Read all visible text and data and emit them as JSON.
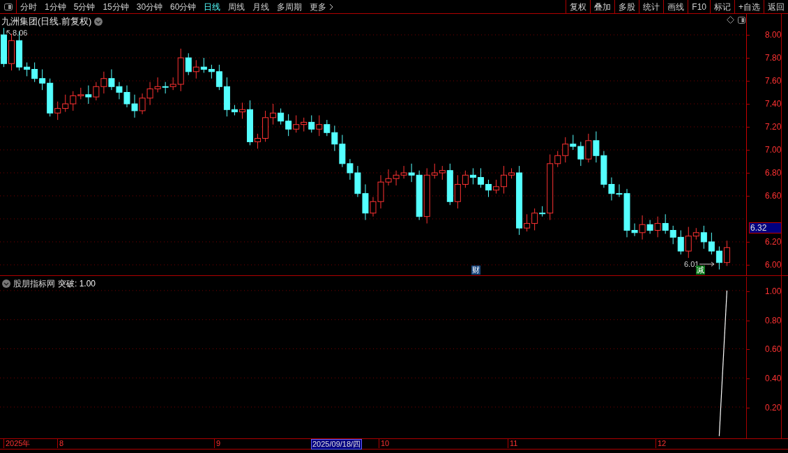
{
  "toolbar": {
    "periods": [
      {
        "label": "分时",
        "selected": false
      },
      {
        "label": "1分钟",
        "selected": false
      },
      {
        "label": "5分钟",
        "selected": false
      },
      {
        "label": "15分钟",
        "selected": false
      },
      {
        "label": "30分钟",
        "selected": false
      },
      {
        "label": "60分钟",
        "selected": false
      },
      {
        "label": "日线",
        "selected": true
      },
      {
        "label": "周线",
        "selected": false
      },
      {
        "label": "月线",
        "selected": false
      },
      {
        "label": "多周期",
        "selected": false
      },
      {
        "label": "更多",
        "selected": false
      }
    ],
    "actions": [
      "复权",
      "叠加",
      "多股",
      "统计",
      "画线",
      "F10",
      "标记",
      "+自选",
      "返回"
    ]
  },
  "main_chart": {
    "title": "九洲集团(日线.前复权)",
    "y_ticks": [
      "8.00",
      "7.80",
      "7.60",
      "7.40",
      "7.20",
      "7.00",
      "6.80",
      "6.60",
      "6.20",
      "6.00"
    ],
    "current_price": "6.32",
    "high_label": "8.06",
    "low_label": "6.01",
    "markers": [
      {
        "text": "财",
        "kind": "finance"
      },
      {
        "text": "减",
        "kind": "reduce"
      }
    ]
  },
  "indicator": {
    "title": "股朋指标网",
    "reading": ": 1.00",
    "chart_data": {
      "type": "line",
      "categories": [
        null,
        null,
        null,
        null,
        null,
        null,
        null,
        null,
        null,
        null,
        null,
        null,
        null,
        null,
        null,
        null,
        null,
        null,
        null,
        null,
        null,
        null,
        null,
        null,
        null,
        null,
        null,
        null,
        null,
        null,
        null,
        null,
        null,
        null,
        null,
        null,
        null,
        null,
        null,
        null,
        null,
        null,
        null,
        null,
        null,
        null,
        null,
        null,
        null,
        null,
        null,
        null,
        null,
        null,
        null,
        null,
        null,
        null,
        null,
        null,
        null,
        null,
        null,
        null,
        null,
        null,
        null,
        null,
        null,
        null,
        null,
        null,
        null,
        null,
        null,
        null,
        null,
        null,
        null,
        null,
        null,
        null,
        null,
        null,
        null,
        null,
        null,
        null,
        null,
        null,
        null,
        null,
        null,
        null,
        null,
        null,
        null
      ],
      "ylim": [
        -0.02,
        1.1
      ],
      "grid": true,
      "yticks": [
        {
          "value": 1,
          "label": "1.00"
        },
        {
          "value": 0.8,
          "label": "0.80"
        },
        {
          "value": 0.6,
          "label": "0.60"
        },
        {
          "value": 0.4,
          "label": "0.40"
        },
        {
          "value": 0.2,
          "label": "0.20"
        }
      ],
      "series": [
        {
          "name": "突破",
          "color": "#ffffff",
          "values": [
            null,
            null,
            null,
            null,
            null,
            null,
            null,
            null,
            null,
            null,
            null,
            null,
            null,
            null,
            null,
            null,
            null,
            null,
            null,
            null,
            null,
            null,
            null,
            null,
            null,
            null,
            null,
            null,
            null,
            null,
            null,
            null,
            null,
            null,
            null,
            null,
            null,
            null,
            null,
            null,
            null,
            null,
            null,
            null,
            null,
            null,
            null,
            null,
            null,
            null,
            null,
            null,
            null,
            null,
            null,
            null,
            null,
            null,
            null,
            null,
            null,
            null,
            null,
            null,
            null,
            null,
            null,
            null,
            null,
            null,
            null,
            null,
            null,
            null,
            null,
            null,
            null,
            null,
            null,
            null,
            null,
            null,
            null,
            null,
            null,
            null,
            null,
            null,
            null,
            null,
            null,
            null,
            null,
            0,
            1,
            null,
            null
          ]
        }
      ]
    }
  },
  "time_axis": [
    {
      "label": "2025年",
      "kind": "year"
    },
    {
      "label": "8",
      "kind": "month"
    },
    {
      "label": "9",
      "kind": "month"
    },
    {
      "label": "2025/09/18/四",
      "kind": "cursor"
    },
    {
      "label": "10",
      "kind": "month"
    },
    {
      "label": "11",
      "kind": "month"
    },
    {
      "label": "12",
      "kind": "month"
    }
  ]
}
